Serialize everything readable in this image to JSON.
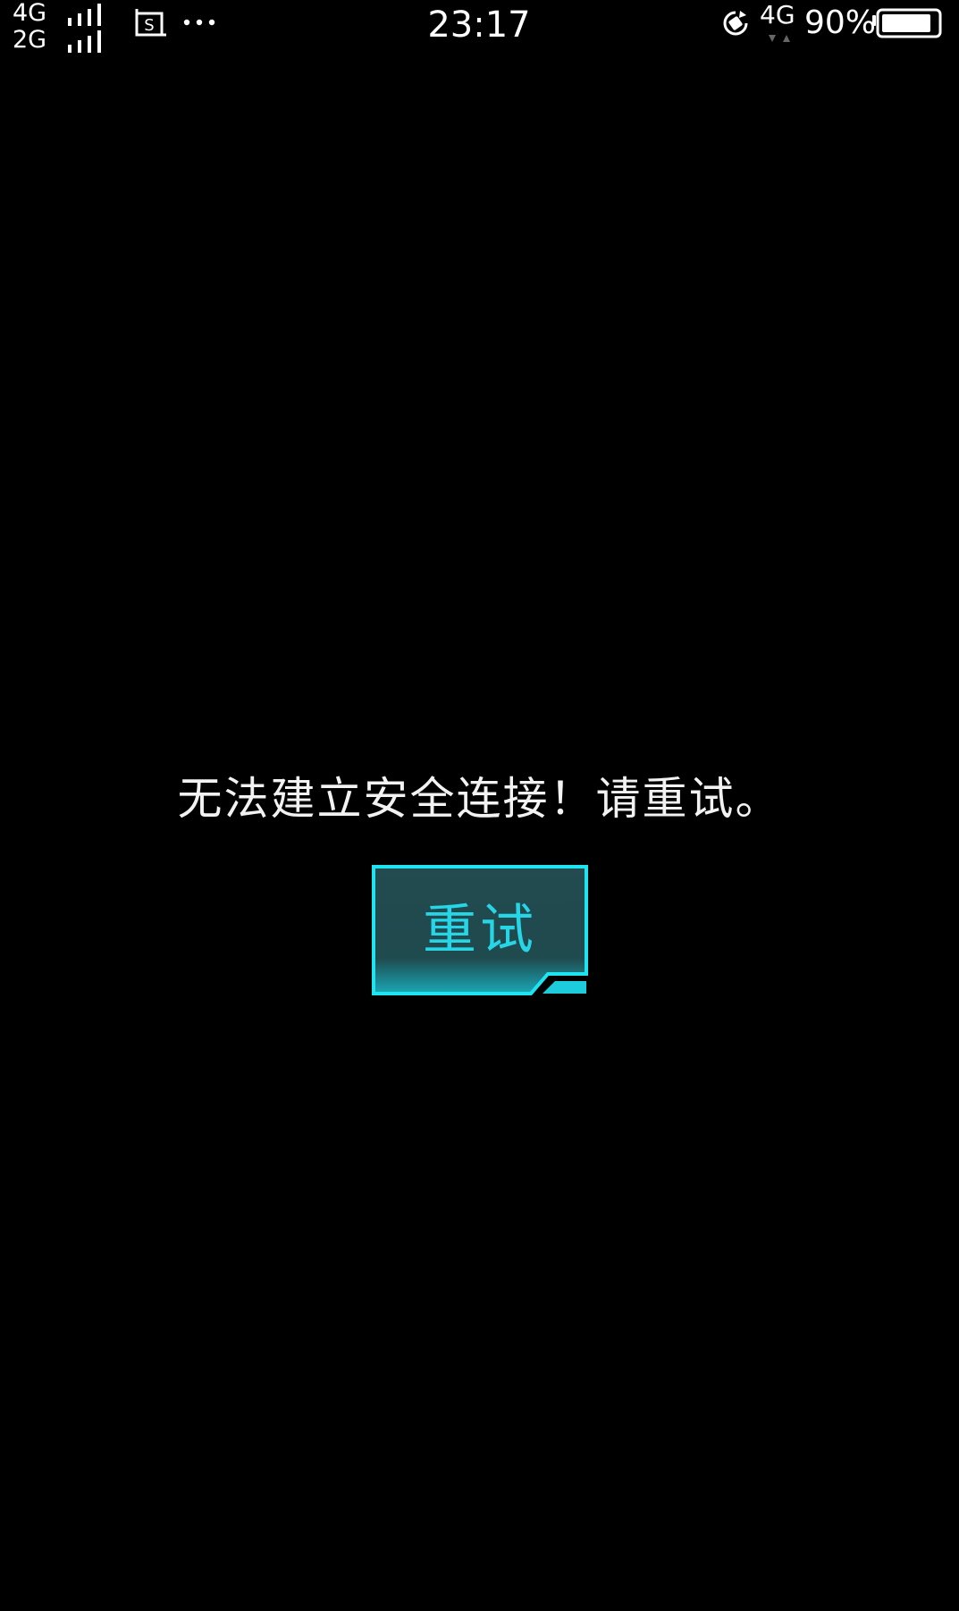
{
  "status_bar": {
    "sim1_network": "4G",
    "sim2_network": "2G",
    "time": "23:17",
    "data_network": "4G",
    "battery_percent": "90%",
    "battery_level": 0.9,
    "icons": [
      "signal-icon",
      "screenshot-icon",
      "more-icon",
      "rotation-lock-icon",
      "data-arrows-icon",
      "battery-icon"
    ]
  },
  "dialog": {
    "message": "无法建立安全连接！请重试。",
    "retry_label": "重试"
  },
  "colors": {
    "background": "#000000",
    "accent": "#27d6e6",
    "button_fill": "#1f4a4e"
  }
}
